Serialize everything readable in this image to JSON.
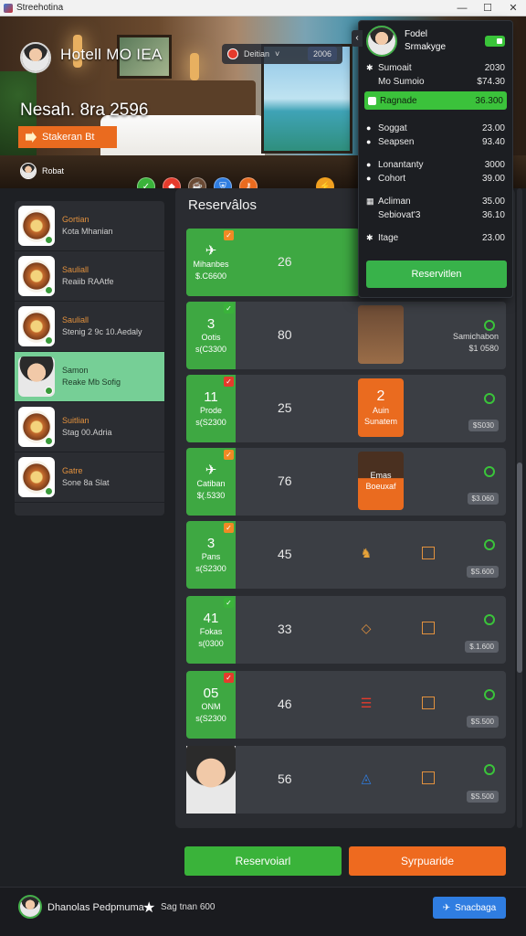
{
  "window": {
    "title": "Streehotina",
    "controls": [
      "—",
      "☐",
      "✕"
    ]
  },
  "hero": {
    "hotel_name": "Hotell MO IEA",
    "headline": "Nesah. 8ra 2596",
    "cta_label": "Stakeran Bt",
    "user_label": "Robat",
    "filter": {
      "label": "Deitian",
      "date": "2006"
    }
  },
  "overlay": {
    "profile_name": "Fodel",
    "profile_sub": "Srmakyge",
    "rows": [
      {
        "label": "Sumoait",
        "value": "2030",
        "icon": "✱"
      },
      {
        "label": "Mo Sumoio",
        "value": "$74.30",
        "icon": ""
      },
      {
        "label": "Ragnade",
        "value": "36.300",
        "icon": "◼",
        "highlight": true
      },
      {
        "label": "Soggat",
        "value": "23.00",
        "icon": "●"
      },
      {
        "label": "Seapsen",
        "value": "93.40",
        "icon": "●"
      },
      {
        "label": "Lonantanty",
        "value": "3000",
        "icon": "●"
      },
      {
        "label": "Cohort",
        "value": "39.00",
        "icon": "●"
      },
      {
        "label": "Acliman",
        "value": "35.00",
        "icon": "▦"
      },
      {
        "label": "Sebiovat'3",
        "value": "36.10",
        "icon": ""
      },
      {
        "label": "Itage",
        "value": "23.00",
        "icon": "✱"
      }
    ],
    "button_label": "Reservitlen"
  },
  "sidebar": {
    "items": [
      {
        "t1": "Gortian",
        "t2": "Kota Mhanian"
      },
      {
        "t1": "Sauliall",
        "t2": "Reaiib RAAtfe"
      },
      {
        "t1": "Sauliall",
        "t2": "Stenig 2 9c 10.Aedaly"
      },
      {
        "t1": "Samon",
        "t2": "Reake Mb Sofig"
      },
      {
        "t1": "Suitlian",
        "t2": "Stag 00.Adria"
      },
      {
        "t1": "Gatre",
        "t2": "Sone 8a Slat"
      }
    ]
  },
  "main": {
    "title": "Reservâlos",
    "rows": [
      {
        "tile_big": "",
        "tile_l1": "Mihanbes",
        "tile_l2": "$.C6600",
        "num": "26"
      },
      {
        "tile_big": "3",
        "tile_l1": "Ootis",
        "tile_l2": "s(C3300",
        "num": "80",
        "right_l1": "Samichabon",
        "right_l2": "$1 0580"
      },
      {
        "tile_big": "11",
        "tile_l1": "Prode",
        "tile_l2": "s(S2300",
        "num": "25",
        "photo_big": "2",
        "photo_l1": "Auin",
        "photo_l2": "Sunatem",
        "pill": "$S030"
      },
      {
        "tile_big": "",
        "tile_l1": "Catiban",
        "tile_l2": "$(.5330",
        "num": "76",
        "photo_l1": "Emas",
        "photo_l2": "Boeuxaf",
        "pill": "$3.060"
      },
      {
        "tile_big": "3",
        "tile_l1": "Pans",
        "tile_l2": "s(S2300",
        "num": "45",
        "pill": "$S.600"
      },
      {
        "tile_big": "41",
        "tile_l1": "Fokas",
        "tile_l2": "s(0300",
        "num": "33",
        "pill": "$.1.600"
      },
      {
        "tile_big": "05",
        "tile_l1": "ONM",
        "tile_l2": "s(S2300",
        "num": "46",
        "pill": "$S.500"
      },
      {
        "tile_big": "",
        "tile_l1": "",
        "tile_l2": "",
        "num": "56",
        "pill": "$S.500"
      }
    ],
    "btn_reserve": "Reservoiarl",
    "btn_secondary": "Syrpuaride"
  },
  "bottom": {
    "name": "Dhanolas",
    "name2": "Pedpmuma",
    "info": "Sag tnan 600",
    "button_label": "Snacbaga"
  },
  "colors": {
    "green": "#3ea842",
    "orange": "#ea6b1f",
    "blue": "#2f7de1",
    "bg": "#1e2024"
  }
}
